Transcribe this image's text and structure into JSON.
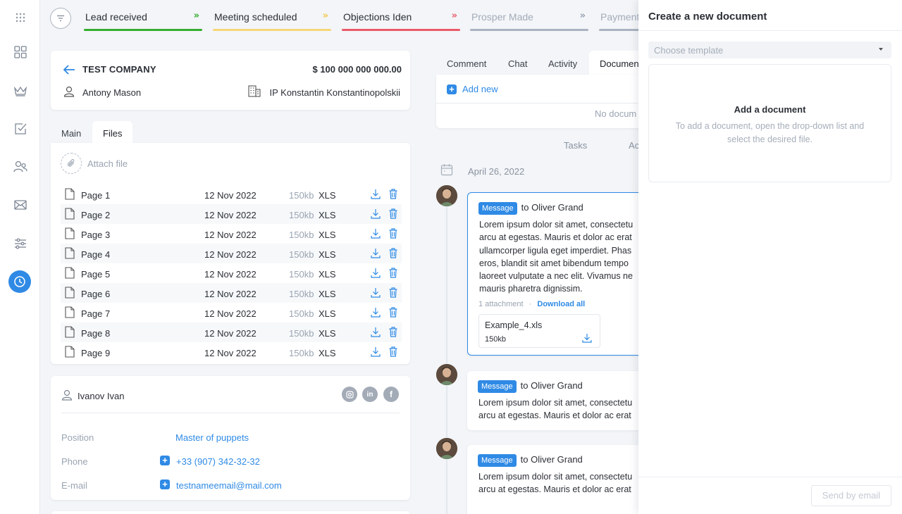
{
  "stages": [
    {
      "label": "Lead received",
      "color": "#36ad2e",
      "arrow_color": "#36ad2e",
      "text_color": "#2b2f36"
    },
    {
      "label": "Meeting scheduled",
      "color": "#f7d67a",
      "arrow_color": "#f2c94c",
      "text_color": "#2b2f36"
    },
    {
      "label": "Objections Iden",
      "color": "#e95b6a",
      "arrow_color": "#e95b6a",
      "text_color": "#2b2f36"
    },
    {
      "label": "Prosper Made",
      "color": "#aab3c0",
      "arrow_color": "#97a2b2",
      "text_color": "#a3acb9"
    },
    {
      "label": "Payment",
      "color": "#aab3c0",
      "arrow_color": "#97a2b2",
      "text_color": "#a3acb9"
    }
  ],
  "company": {
    "name": "TEST COMPANY",
    "amount": "$ 100 000 000 000.00",
    "contact": "Antony Mason",
    "organization": "IP Konstantin Konstantinopolskii"
  },
  "left_tabs": [
    "Main",
    "Files"
  ],
  "files": {
    "attach_label": "Attach file",
    "rows": [
      {
        "name": "Page 1",
        "date": "12 Nov 2022",
        "size": "150kb",
        "type": "XLS"
      },
      {
        "name": "Page 2",
        "date": "12 Nov 2022",
        "size": "150kb",
        "type": "XLS"
      },
      {
        "name": "Page 3",
        "date": "12 Nov 2022",
        "size": "150kb",
        "type": "XLS"
      },
      {
        "name": "Page 4",
        "date": "12 Nov 2022",
        "size": "150kb",
        "type": "XLS"
      },
      {
        "name": "Page 5",
        "date": "12 Nov 2022",
        "size": "150kb",
        "type": "XLS"
      },
      {
        "name": "Page 6",
        "date": "12 Nov 2022",
        "size": "150kb",
        "type": "XLS"
      },
      {
        "name": "Page 7",
        "date": "12 Nov 2022",
        "size": "150kb",
        "type": "XLS"
      },
      {
        "name": "Page 8",
        "date": "12 Nov 2022",
        "size": "150kb",
        "type": "XLS"
      },
      {
        "name": "Page 9",
        "date": "12 Nov 2022",
        "size": "150kb",
        "type": "XLS"
      }
    ]
  },
  "person": {
    "name": "Ivanov Ivan",
    "social": [
      "instagram-icon",
      "linkedin-icon",
      "facebook-icon"
    ],
    "position_label": "Position",
    "position_value": "Master of  puppets",
    "phone_label": "Phone",
    "phone_value": "+33 (907) 342-32-32",
    "email_label": "E-mail",
    "email_value": "testnameemail@mail.com"
  },
  "right_tabs": [
    "Comment",
    "Chat",
    "Activity",
    "Documen"
  ],
  "documents": {
    "add_new": "Add new",
    "empty": "No docum"
  },
  "sub_tabs": [
    "Tasks",
    "Ac"
  ],
  "timeline": {
    "date": "April 26, 2022",
    "messages": [
      {
        "badge": "Message",
        "to": "to Oliver Grand",
        "body": "Lorem ipsum dolor sit amet, consectetu\narcu at egestas. Mauris et dolor ac erat\nullamcorper ligula eget imperdiet. Phas\neros, blandit sit amet bibendum tempo\nlaoreet vulputate a nec elit. Vivamus ne\nmauris pharetra dignissim.",
        "attachments": "1 attachment",
        "sep": "·",
        "download_all": "Download all",
        "file_name": "Example_4.xls",
        "file_size": "150kb"
      },
      {
        "badge": "Message",
        "to": "to Oliver Grand",
        "body": "Lorem ipsum dolor sit amet, consectetu\narcu at egestas. Mauris et dolor ac erat"
      },
      {
        "badge": "Message",
        "to": "to Oliver Grand",
        "body": "Lorem ipsum dolor sit amet, consectetu\narcu at egestas. Mauris et dolor ac erat"
      }
    ]
  },
  "panel": {
    "title": "Create a new document",
    "select_placeholder": "Choose template",
    "empty_title": "Add a document",
    "empty_text": "To add a document, open the drop-down list and\nselect the desired file.",
    "send_button": "Send by email"
  },
  "colors": {
    "accent": "#2f8ae5"
  }
}
